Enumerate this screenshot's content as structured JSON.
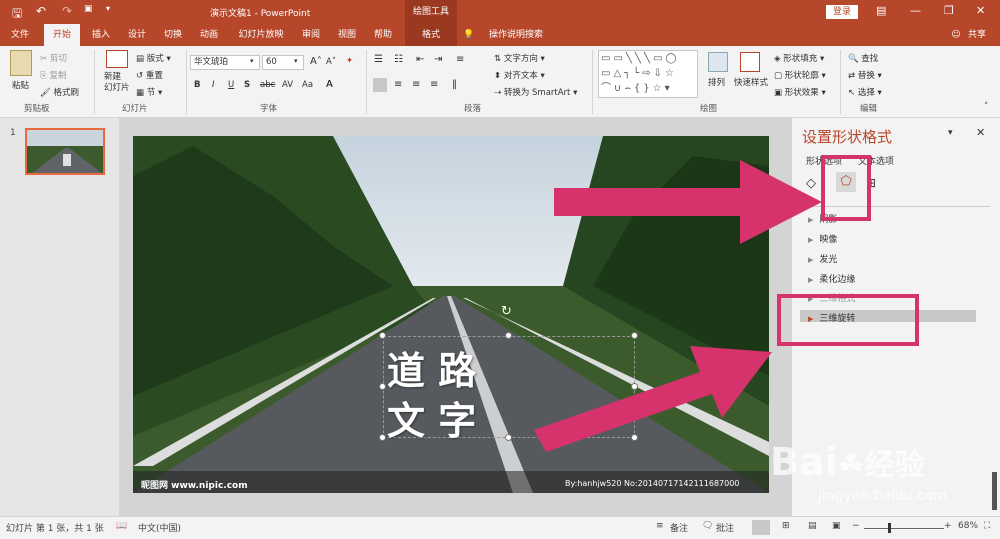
{
  "titlebar": {
    "document_title": "演示文稿1 - PowerPoint",
    "tool_context_label": "绘图工具",
    "login_label": "登录"
  },
  "tabs": [
    "文件",
    "开始",
    "插入",
    "设计",
    "切换",
    "动画",
    "幻灯片放映",
    "审阅",
    "视图",
    "帮助",
    "格式"
  ],
  "active_tab": "开始",
  "tell_me": "操作说明搜索",
  "share_label": "共享",
  "ribbon": {
    "clipboard": {
      "paste": "粘贴",
      "cut": "剪切",
      "copy": "复制",
      "format_painter": "格式刷",
      "group": "剪贴板"
    },
    "slides": {
      "new_slide": "新建\n幻灯片",
      "layout": "版式",
      "reset": "重置",
      "section": "节",
      "group": "幻灯片"
    },
    "font": {
      "font_name": "华文琥珀",
      "font_size": "60",
      "group": "字体"
    },
    "paragraph": {
      "text_direction": "文字方向",
      "align_text": "对齐文本",
      "smartart": "转换为 SmartArt",
      "group": "段落"
    },
    "drawing": {
      "arrange": "排列",
      "quick_styles": "快速样式",
      "shape_fill": "形状填充",
      "shape_outline": "形状轮廓",
      "shape_effects": "形状效果",
      "group": "绘图"
    },
    "editing": {
      "find": "查找",
      "replace": "替换",
      "select": "选择",
      "group": "编辑"
    }
  },
  "slide_panel": {
    "slide_number": "1"
  },
  "slide": {
    "text_line1": "道 路",
    "text_line2": "文 字",
    "watermark_left": "昵图网 www.nipic.com",
    "watermark_right": "By:hanhjw520 No:20140717142111687000"
  },
  "format_pane": {
    "title": "设置形状格式",
    "tab_shape_options": "形状选项",
    "tab_text_options": "文本选项",
    "sections": [
      "阴影",
      "映像",
      "发光",
      "柔化边缘",
      "三维格式",
      "三维旋转"
    ],
    "highlighted_section": "三维旋转"
  },
  "statusbar": {
    "slide_info": "幻灯片 第 1 张，共 1 张",
    "language": "中文(中国)",
    "notes": "备注",
    "comments": "批注",
    "zoom": "68%"
  },
  "brand_watermark": {
    "text1": "Bai",
    "text2": "经验",
    "url": "jingyan.baidu.com"
  },
  "colors": {
    "accent": "#b7472a",
    "annotation_pink": "#d6336c"
  }
}
